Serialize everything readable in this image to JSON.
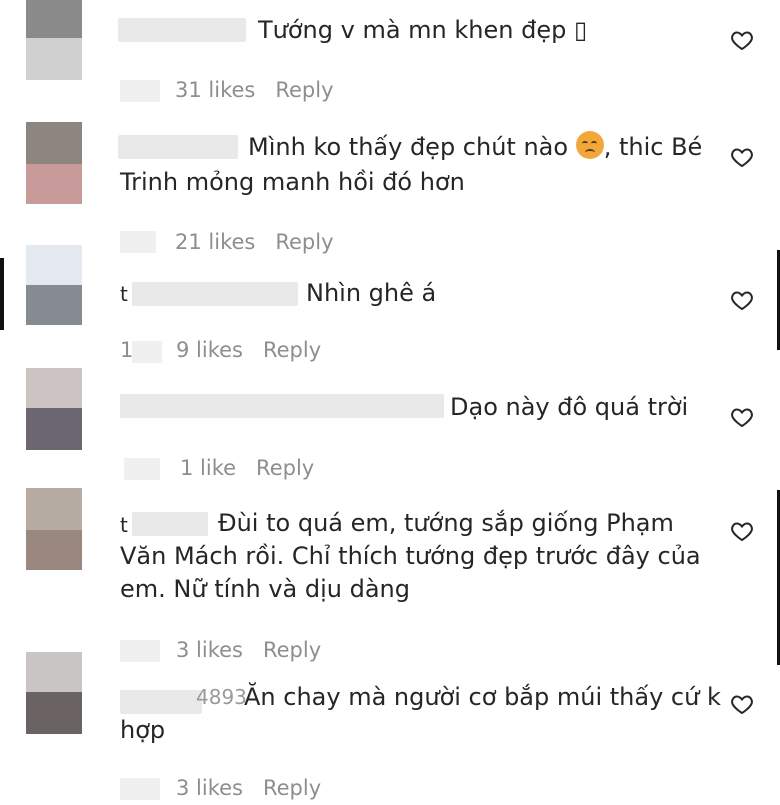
{
  "comments": [
    {
      "avatar": [
        "#8a8a8a",
        "#c8c8c8"
      ],
      "text": "Tướng v mà mn khen đẹp ",
      "trail_glyph": "▯",
      "likes": "31 likes",
      "reply": "Reply"
    },
    {
      "avatar": [
        "#8d8580",
        "#c99a9a"
      ],
      "text_line1": "Mình ko thấy đẹp chút nào ",
      "text_line1_after": ", thic Bé",
      "text_line2": "Trinh mỏng manh hồi đó hơn",
      "emoji": "pensive-face",
      "likes": "21 likes",
      "reply": "Reply"
    },
    {
      "avatar": [
        "#e4e8f0",
        "#868a91"
      ],
      "handle_prefix": "t",
      "text": "Nhìn ghê á",
      "likes_prefix": "1",
      "likes": "9 likes",
      "reply": "Reply"
    },
    {
      "avatar": [
        "#ccc3c3",
        "#6c6670"
      ],
      "text": "Dạo này đô quá trời",
      "likes": "1 like",
      "reply": "Reply"
    },
    {
      "avatar": [
        "#b6aca3",
        "#9a8880"
      ],
      "handle_prefix": "t",
      "text_line1": "Đùi to quá em, tướng sắp giống Phạm",
      "text_line2": "Văn Mách rồi. Chỉ thích tướng đẹp trước đây của",
      "text_line3": "em. Nữ tính và dịu dàng",
      "likes": "3 likes",
      "reply": "Reply"
    },
    {
      "avatar": [
        "#c9c5c5",
        "#6b6363"
      ],
      "handle_suffix": "4893",
      "text_line1": "Ăn chay mà người cơ bắp múi thấy cứ k",
      "text_line2": "hợp",
      "likes": "3 likes",
      "reply": "Reply"
    }
  ]
}
